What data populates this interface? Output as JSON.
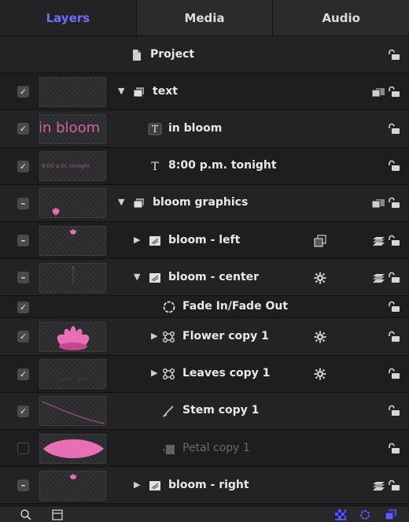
{
  "tabs": [
    {
      "label": "Layers",
      "active": true
    },
    {
      "label": "Media",
      "active": false
    },
    {
      "label": "Audio",
      "active": false
    }
  ],
  "rows": [
    {
      "label": "Project",
      "icon": "document-icon",
      "check": "none",
      "thumb": "none",
      "disclosure": "",
      "indent": 0,
      "right_icon": "",
      "right_icon2": "",
      "dimmed": false
    },
    {
      "label": "text",
      "icon": "group-icon",
      "check": "checked",
      "thumb": "blank",
      "disclosure": "▼",
      "indent": 1,
      "right_icon": "",
      "right_icon2": "group-stack-icon",
      "dimmed": false
    },
    {
      "label": "in bloom",
      "icon": "text-box-icon",
      "check": "checked",
      "thumb": "text-in-bloom",
      "thumb_text": "in bloom",
      "disclosure": "",
      "indent": 2,
      "right_icon": "",
      "right_icon2": "",
      "dimmed": false
    },
    {
      "label": "8:00 p.m. tonight",
      "icon": "text-icon",
      "check": "checked",
      "thumb": "text-time",
      "thumb_text": "8:00 p.m. tonight",
      "disclosure": "",
      "indent": 2,
      "right_icon": "",
      "right_icon2": "",
      "dimmed": false
    },
    {
      "label": "bloom graphics",
      "icon": "group-icon",
      "check": "mixed",
      "thumb": "flower-small",
      "disclosure": "▼",
      "indent": 1,
      "right_icon": "",
      "right_icon2": "group-stack-icon",
      "dimmed": false
    },
    {
      "label": "bloom - left",
      "icon": "layer-icon",
      "check": "mixed",
      "thumb": "flower-tiny",
      "disclosure": "▶",
      "indent": 2,
      "right_icon": "clone-icon",
      "right_icon2": "layers-stack-icon",
      "dimmed": false
    },
    {
      "label": "bloom - center",
      "icon": "layer-icon",
      "check": "mixed",
      "thumb": "stem",
      "disclosure": "▼",
      "indent": 2,
      "right_icon": "gear-icon",
      "right_icon2": "layers-stack-icon",
      "dimmed": false
    },
    {
      "label": "Fade In/Fade Out",
      "icon": "behavior-icon",
      "check": "checked",
      "thumb": "none",
      "disclosure": "",
      "indent": 3,
      "right_icon": "",
      "right_icon2": "",
      "dimmed": false,
      "short": true
    },
    {
      "label": "Flower copy 1",
      "icon": "replicator-icon",
      "check": "checked",
      "thumb": "flower-big",
      "disclosure": "▶",
      "indent": 3,
      "right_icon": "gear-icon",
      "right_icon2": "",
      "dimmed": false
    },
    {
      "label": "Leaves copy 1",
      "icon": "replicator-icon",
      "check": "checked",
      "thumb": "leaves",
      "disclosure": "▶",
      "indent": 3,
      "right_icon": "gear-icon",
      "right_icon2": "",
      "dimmed": false
    },
    {
      "label": "Stem copy 1",
      "icon": "brush-icon",
      "check": "checked",
      "thumb": "stem-line",
      "disclosure": "",
      "indent": 3,
      "right_icon": "",
      "right_icon2": "",
      "dimmed": false
    },
    {
      "label": "Petal copy 1",
      "icon": "paint-icon",
      "check": "empty",
      "thumb": "petal",
      "disclosure": "",
      "indent": 3,
      "right_icon": "",
      "right_icon2": "",
      "dimmed": true
    },
    {
      "label": "bloom - right",
      "icon": "layer-icon",
      "check": "mixed",
      "thumb": "flower-tiny",
      "disclosure": "▶",
      "indent": 2,
      "right_icon": "",
      "right_icon2": "layers-stack-icon",
      "dimmed": false
    }
  ],
  "bottom_bar": {
    "left_icons": [
      "search-icon",
      "panel-toggle-icon"
    ],
    "right_icons": [
      "checker-mask-icon",
      "behavior-filter-icon",
      "layers-filter-icon"
    ]
  },
  "colors": {
    "accent": "#6d6dff",
    "pink": "#e86fb5",
    "background": "#1c1c1e"
  }
}
